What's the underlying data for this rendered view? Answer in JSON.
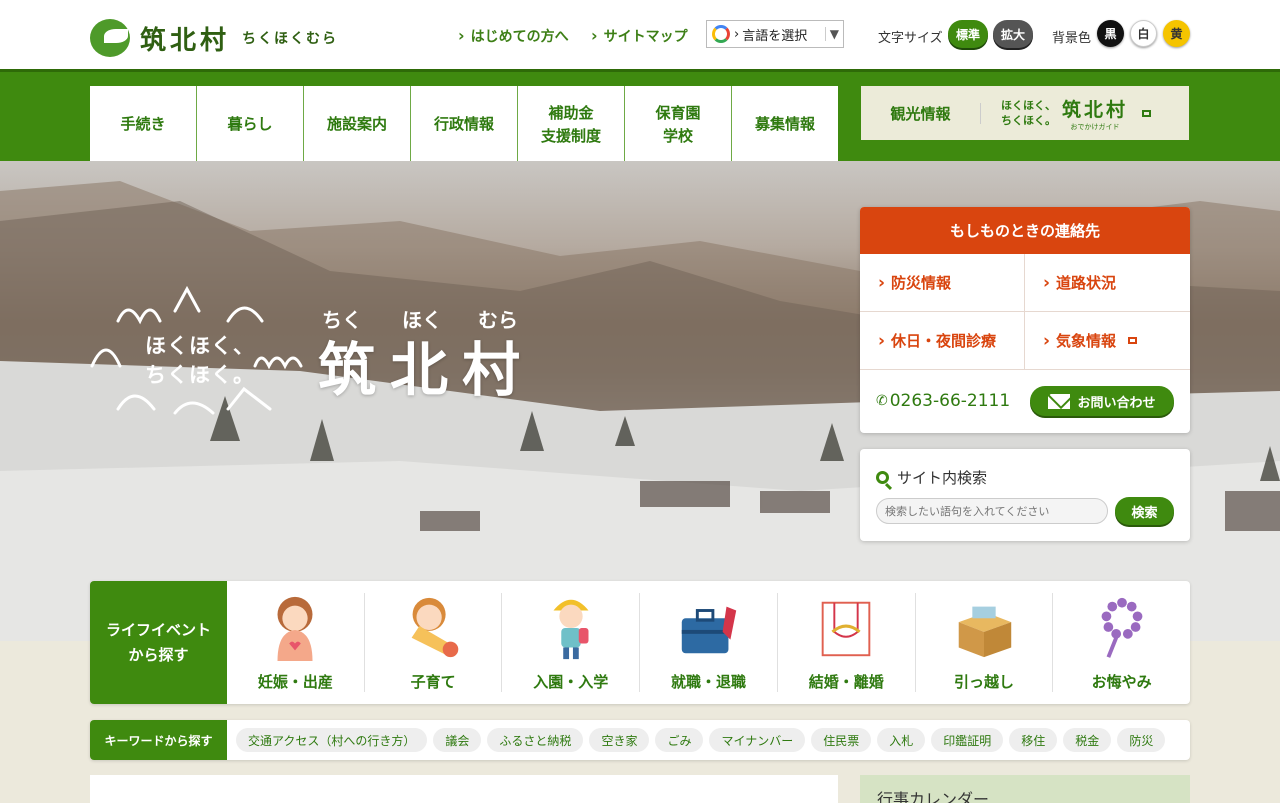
{
  "header": {
    "logo_name": "筑北村",
    "logo_kana": "ちくほくむら",
    "links": [
      "はじめての方へ",
      "サイトマップ"
    ],
    "translate_label": "言語を選択",
    "font_size_label": "文字サイズ",
    "font_sizes": [
      "標準",
      "拡大"
    ],
    "bg_label": "背景色",
    "bg_colors": [
      "黒",
      "白",
      "黄"
    ]
  },
  "nav": {
    "items": [
      "手続き",
      "暮らし",
      "施設案内",
      "行政情報",
      "補助金\n支援制度",
      "保育園\n学校",
      "募集情報"
    ],
    "tourism_label": "観光情報",
    "tourism_logo_small": "ほくほく、\nちくほく。",
    "tourism_logo_big": "筑北村",
    "tourism_logo_sub": "おでかけガイド"
  },
  "hero": {
    "kana": [
      "ちく",
      "ほく",
      "むら"
    ],
    "title": "筑北村",
    "tagline_1": "ほくほく、",
    "tagline_2": "ちくほく。"
  },
  "emergency": {
    "title": "もしものときの連絡先",
    "links": [
      "防災情報",
      "道路状況",
      "休日・夜間診療",
      "気象情報"
    ],
    "phone": "0263-66-2111",
    "contact_label": "お問い合わせ"
  },
  "search": {
    "title": "サイト内検索",
    "placeholder": "検索したい語句を入れてください",
    "button": "検索"
  },
  "life_events": {
    "label": "ライフイベント\nから探す",
    "items": [
      "妊娠・出産",
      "子育て",
      "入園・入学",
      "就職・退職",
      "結婚・離婚",
      "引っ越し",
      "お悔やみ"
    ]
  },
  "keywords": {
    "label": "キーワードから探す",
    "tags": [
      "交通アクセス（村への行き方）",
      "議会",
      "ふるさと納税",
      "空き家",
      "ごみ",
      "マイナンバー",
      "住民票",
      "入札",
      "印鑑証明",
      "移住",
      "税金",
      "防災"
    ]
  },
  "calendar": {
    "title": "行事カレンダー"
  },
  "colors": {
    "brand_green": "#3f8a0f",
    "emergency_orange": "#d9450f"
  }
}
